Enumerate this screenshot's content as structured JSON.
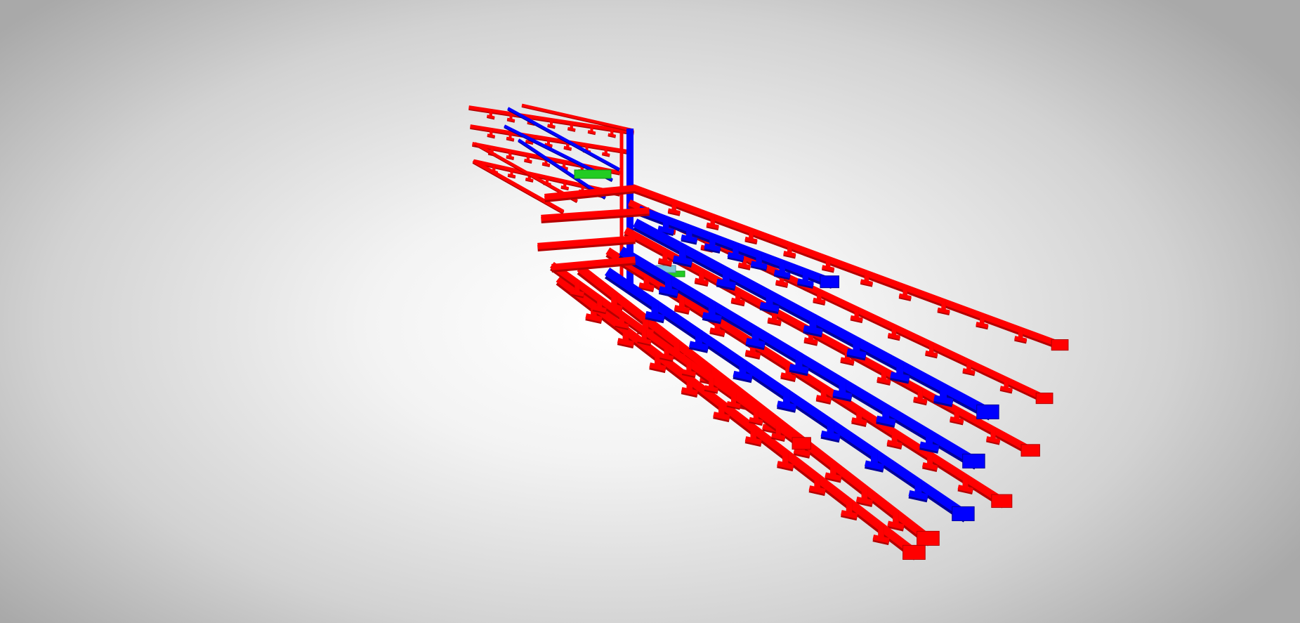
{
  "viewer": {
    "background": [
      "#ffffff",
      "#a9a9a9"
    ]
  },
  "colors": {
    "red_pipe": "#ff0000",
    "red_pipe_dark": "#b40000",
    "blue_duct": "#0000ff",
    "blue_duct_dark": "#00009a",
    "green_equipment": "#22cc22",
    "cyan_equipment": "#7fc6d8"
  },
  "scene": {
    "icons": [
      "red-pipe-run",
      "blue-duct-run",
      "green-equipment",
      "vertical-riser"
    ]
  }
}
